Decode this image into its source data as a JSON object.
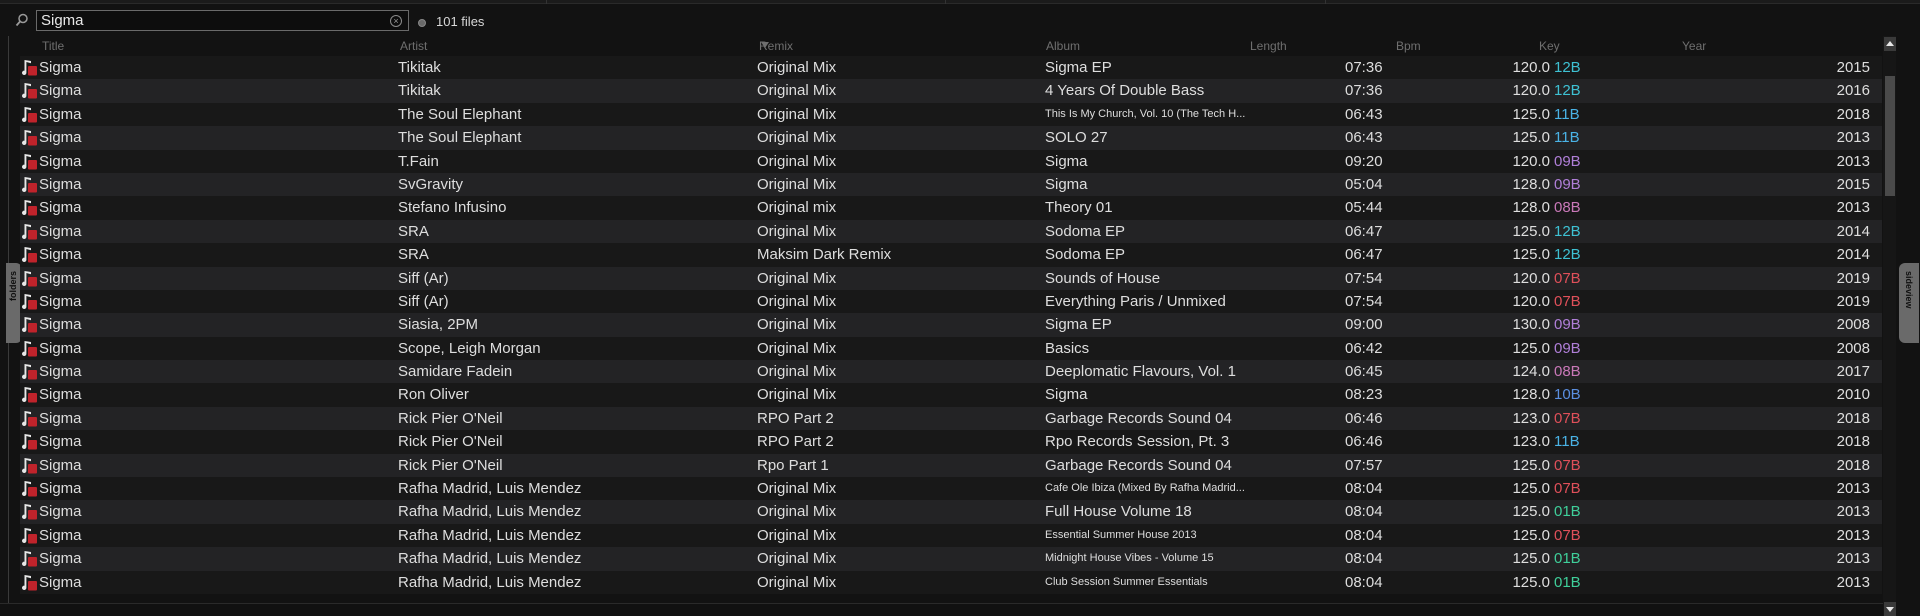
{
  "search": {
    "value": "Sigma",
    "clear_icon": "clear-circle-icon",
    "files_count": "101 files"
  },
  "side_tabs": {
    "left": "folders",
    "right": "sideview"
  },
  "columns": [
    "Title",
    "Artist",
    "Remix",
    "Album",
    "Length",
    "Bpm",
    "Key",
    "Year"
  ],
  "colors": {
    "background": "#121212",
    "row_odd": "#181818",
    "row_even": "#232325",
    "key_12B": "#3ec1d3",
    "key_11B": "#4ab3e6",
    "key_10B": "#5b8fe0",
    "key_09B": "#b07fd8",
    "key_08B": "#c978b8",
    "key_07B": "#e0505a",
    "key_01B": "#3fcf9a",
    "track_icon": "#c0232b"
  },
  "rows": [
    {
      "title": "Sigma",
      "artist": "Tikitak",
      "remix": "Original Mix",
      "album": "Sigma EP",
      "album_small": false,
      "length": "07:36",
      "bpm": "120.0",
      "key": "12B",
      "year": "2015"
    },
    {
      "title": "Sigma",
      "artist": "Tikitak",
      "remix": "Original Mix",
      "album": "4 Years Of Double Bass",
      "album_small": false,
      "length": "07:36",
      "bpm": "120.0",
      "key": "12B",
      "year": "2016"
    },
    {
      "title": "Sigma",
      "artist": "The Soul Elephant",
      "remix": "Original Mix",
      "album": "This Is My Church, Vol. 10 (The Tech H...",
      "album_small": true,
      "length": "06:43",
      "bpm": "125.0",
      "key": "11B",
      "year": "2018"
    },
    {
      "title": "Sigma",
      "artist": "The Soul Elephant",
      "remix": "Original Mix",
      "album": "SOLO 27",
      "album_small": false,
      "length": "06:43",
      "bpm": "125.0",
      "key": "11B",
      "year": "2013"
    },
    {
      "title": "Sigma",
      "artist": "T.Fain",
      "remix": "Original Mix",
      "album": "Sigma",
      "album_small": false,
      "length": "09:20",
      "bpm": "120.0",
      "key": "09B",
      "year": "2013"
    },
    {
      "title": "Sigma",
      "artist": "SvGravity",
      "remix": "Original Mix",
      "album": "Sigma",
      "album_small": false,
      "length": "05:04",
      "bpm": "128.0",
      "key": "09B",
      "year": "2015"
    },
    {
      "title": "Sigma",
      "artist": "Stefano Infusino",
      "remix": "Original mix",
      "album": "Theory 01",
      "album_small": false,
      "length": "05:44",
      "bpm": "128.0",
      "key": "08B",
      "year": "2013"
    },
    {
      "title": "Sigma",
      "artist": "SRA",
      "remix": "Original Mix",
      "album": "Sodoma EP",
      "album_small": false,
      "length": "06:47",
      "bpm": "125.0",
      "key": "12B",
      "year": "2014"
    },
    {
      "title": "Sigma",
      "artist": "SRA",
      "remix": "Maksim Dark Remix",
      "album": "Sodoma EP",
      "album_small": false,
      "length": "06:47",
      "bpm": "125.0",
      "key": "12B",
      "year": "2014"
    },
    {
      "title": "Sigma",
      "artist": "Siff (Ar)",
      "remix": "Original Mix",
      "album": "Sounds of House",
      "album_small": false,
      "length": "07:54",
      "bpm": "120.0",
      "key": "07B",
      "year": "2019"
    },
    {
      "title": "Sigma",
      "artist": "Siff (Ar)",
      "remix": "Original Mix",
      "album": "Everything Paris / Unmixed",
      "album_small": false,
      "length": "07:54",
      "bpm": "120.0",
      "key": "07B",
      "year": "2019"
    },
    {
      "title": "Sigma",
      "artist": "Siasia, 2PM",
      "remix": "Original Mix",
      "album": "Sigma EP",
      "album_small": false,
      "length": "09:00",
      "bpm": "130.0",
      "key": "09B",
      "year": "2008"
    },
    {
      "title": "Sigma",
      "artist": "Scope, Leigh Morgan",
      "remix": "Original Mix",
      "album": "Basics",
      "album_small": false,
      "length": "06:42",
      "bpm": "125.0",
      "key": "09B",
      "year": "2008"
    },
    {
      "title": "Sigma",
      "artist": "Samidare Fadein",
      "remix": "Original Mix",
      "album": "Deeplomatic Flavours, Vol. 1",
      "album_small": false,
      "length": "06:45",
      "bpm": "124.0",
      "key": "08B",
      "year": "2017"
    },
    {
      "title": "Sigma",
      "artist": "Ron Oliver",
      "remix": "Original Mix",
      "album": "Sigma",
      "album_small": false,
      "length": "08:23",
      "bpm": "128.0",
      "key": "10B",
      "year": "2010"
    },
    {
      "title": "Sigma",
      "artist": "Rick Pier O'Neil",
      "remix": "RPO Part 2",
      "album": "Garbage Records Sound 04",
      "album_small": false,
      "length": "06:46",
      "bpm": "123.0",
      "key": "07B",
      "year": "2018"
    },
    {
      "title": "Sigma",
      "artist": "Rick Pier O'Neil",
      "remix": "RPO Part 2",
      "album": "Rpo Records Session, Pt. 3",
      "album_small": false,
      "length": "06:46",
      "bpm": "123.0",
      "key": "11B",
      "year": "2018"
    },
    {
      "title": "Sigma",
      "artist": "Rick Pier O'Neil",
      "remix": "Rpo Part 1",
      "album": "Garbage Records Sound 04",
      "album_small": false,
      "length": "07:57",
      "bpm": "125.0",
      "key": "07B",
      "year": "2018"
    },
    {
      "title": "Sigma",
      "artist": "Rafha Madrid, Luis Mendez",
      "remix": "Original Mix",
      "album": "Cafe Ole Ibiza (Mixed By Rafha Madrid...",
      "album_small": true,
      "length": "08:04",
      "bpm": "125.0",
      "key": "07B",
      "year": "2013"
    },
    {
      "title": "Sigma",
      "artist": "Rafha Madrid, Luis Mendez",
      "remix": "Original Mix",
      "album": "Full House Volume 18",
      "album_small": false,
      "length": "08:04",
      "bpm": "125.0",
      "key": "01B",
      "year": "2013"
    },
    {
      "title": "Sigma",
      "artist": "Rafha Madrid, Luis Mendez",
      "remix": "Original Mix",
      "album": "Essential Summer House 2013",
      "album_small": true,
      "length": "08:04",
      "bpm": "125.0",
      "key": "07B",
      "year": "2013"
    },
    {
      "title": "Sigma",
      "artist": "Rafha Madrid, Luis Mendez",
      "remix": "Original Mix",
      "album": "Midnight House Vibes - Volume 15",
      "album_small": true,
      "length": "08:04",
      "bpm": "125.0",
      "key": "01B",
      "year": "2013"
    },
    {
      "title": "Sigma",
      "artist": "Rafha Madrid, Luis Mendez",
      "remix": "Original Mix",
      "album": "Club Session Summer Essentials",
      "album_small": true,
      "length": "08:04",
      "bpm": "125.0",
      "key": "01B",
      "year": "2013"
    }
  ]
}
